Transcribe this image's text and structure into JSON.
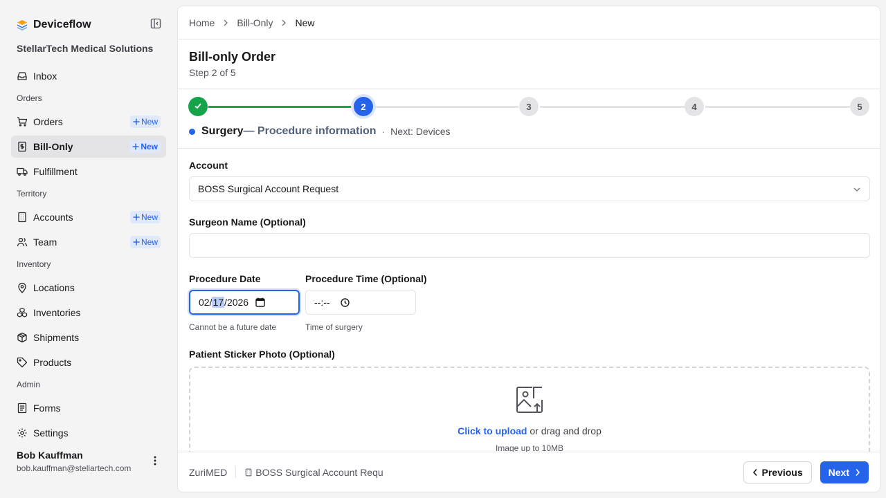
{
  "app": {
    "name": "Deviceflow",
    "org": "StellarTech Medical Solutions"
  },
  "sidebar": {
    "inbox": "Inbox",
    "sections": {
      "orders": "Orders",
      "territory": "Territory",
      "inventory": "Inventory",
      "admin": "Admin"
    },
    "new_label": "New",
    "items": {
      "orders": "Orders",
      "bill_only": "Bill-Only",
      "fulfillment": "Fulfillment",
      "accounts": "Accounts",
      "team": "Team",
      "locations": "Locations",
      "inventories": "Inventories",
      "shipments": "Shipments",
      "products": "Products",
      "forms": "Forms",
      "settings": "Settings"
    },
    "active_item": "Bill-Only"
  },
  "user": {
    "name": "Bob Kauffman",
    "email": "bob.kauffman@stellartech.com"
  },
  "breadcrumb": {
    "home": "Home",
    "section": "Bill-Only",
    "current": "New"
  },
  "page": {
    "title": "Bill-only Order",
    "step_text": "Step 2 of 5"
  },
  "stepper": {
    "steps": [
      "",
      "2",
      "3",
      "4",
      "5"
    ],
    "current_step": 2,
    "total_steps": 5,
    "current_title": "Surgery",
    "current_subtitle": "— Procedure information",
    "separator": "·",
    "next_text": "Next: Devices",
    "colors": {
      "done": "#16a34a",
      "current": "#2563eb",
      "pending": "#e4e4e7"
    }
  },
  "form": {
    "account_label": "Account",
    "account_value": "BOSS Surgical Account Request",
    "surgeon_label": "Surgeon Name (Optional)",
    "surgeon_value": "",
    "date_label": "Procedure Date",
    "date_month": "02",
    "date_day": "17",
    "date_year": "2026",
    "date_sep": "/",
    "date_hint": "Cannot be a future date",
    "time_label": "Procedure Time (Optional)",
    "time_value": "--:-- ",
    "time_hint": "Time of surgery",
    "photo_label": "Patient Sticker Photo (Optional)",
    "upload_link": "Click to upload",
    "upload_rest": " or drag and drop",
    "upload_hint": "Image up to 10MB"
  },
  "footer": {
    "org": "ZuriMED",
    "account": "BOSS Surgical Account Reque",
    "prev": "Previous",
    "next": "Next"
  },
  "icons": {
    "brand": "deviceflow-logo-icon",
    "collapse": "sidebar-collapse-icon",
    "inbox": "inbox-icon",
    "orders": "cart-icon",
    "bill_only": "receipt-dollar-icon",
    "fulfillment": "truck-icon",
    "accounts": "building-icon",
    "team": "users-icon",
    "locations": "map-pin-icon",
    "inventories": "boxes-icon",
    "shipments": "package-icon",
    "products": "tag-icon",
    "forms": "form-icon",
    "settings": "gear-icon"
  }
}
